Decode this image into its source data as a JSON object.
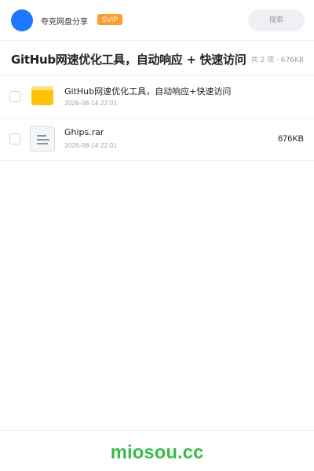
{
  "header": {
    "app_name": "夸克网盘分享",
    "badge": "SVIP",
    "search_label": "搜索",
    "colors": {
      "avatar": "#1e77ff",
      "badge_bg": "#ff9a2e"
    }
  },
  "title_bar": {
    "title": "GitHub网速优化工具，自动响应 + 快速访问",
    "summary": "共 2 项 · 676KB"
  },
  "files": [
    {
      "icon": "folder-icon",
      "name": "GitHub网速优化工具，自动响应+快速访问",
      "date": "2026-08-14 22:01",
      "size": ""
    },
    {
      "icon": "file-icon",
      "name": "Ghips.rar",
      "date": "2026-08-14 22:01",
      "size": "676KB"
    }
  ],
  "footer": {
    "brand": "miosou.cc",
    "brand_color": "#3dbb4a"
  }
}
